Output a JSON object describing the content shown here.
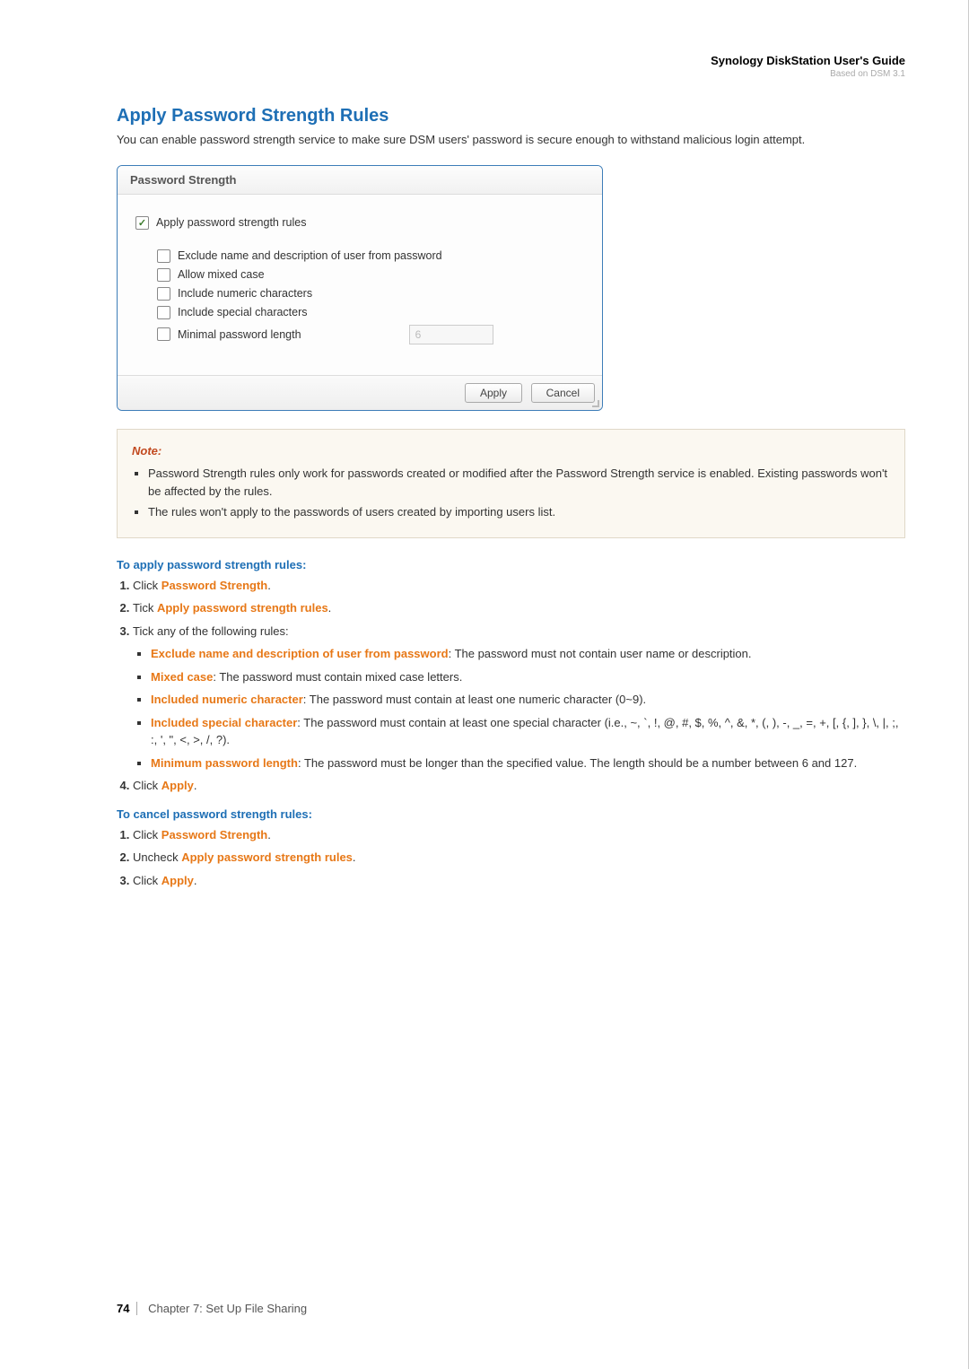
{
  "header": {
    "guide_title": "Synology DiskStation User's Guide",
    "guide_sub": "Based on DSM 3.1"
  },
  "section": {
    "title": "Apply Password Strength Rules",
    "intro": "You can enable password strength service to make sure DSM users' password is secure enough to withstand malicious login attempt."
  },
  "panel": {
    "title": "Password Strength",
    "main_rule": "Apply password strength rules",
    "sub_rules": {
      "exclude": "Exclude name and description of user from password",
      "mixed": "Allow mixed case",
      "numeric": "Include numeric characters",
      "special": "Include special characters",
      "minlen": "Minimal password length"
    },
    "minlen_value": "6",
    "buttons": {
      "apply": "Apply",
      "cancel": "Cancel"
    }
  },
  "note": {
    "label": "Note:",
    "items": [
      "Password Strength rules only work for passwords created or modified after the Password Strength service is enabled. Existing passwords won't be affected by the rules.",
      "The rules won't apply to the passwords of users created by importing users list."
    ]
  },
  "apply_steps": {
    "heading": "To apply password strength rules:",
    "step1_pre": "Click ",
    "step1_kw": "Password Strength",
    "step2_pre": "Tick ",
    "step2_kw": "Apply password strength rules",
    "step3": "Tick any of the following rules:",
    "rules": {
      "exclude_kw": "Exclude name and description of user from password",
      "exclude_txt": ": The password must not contain user name or description.",
      "mixed_kw": "Mixed case",
      "mixed_txt": ": The password must contain mixed case letters.",
      "numeric_kw": "Included numeric character",
      "numeric_txt": ": The password must contain at least one numeric character (0~9).",
      "special_kw": "Included special character",
      "special_txt": ": The password must contain at least one special character (i.e., ~, `, !, @, #, $, %, ^, &, *, (, ), -, _, =, +, [, {, ], }, \\, |, ;, :, ', \", <, >, /, ?).",
      "minlen_kw": "Minimum password length",
      "minlen_txt": ": The password must be longer than the specified value. The length should be a number between 6 and 127."
    },
    "step4_pre": "Click ",
    "step4_kw": "Apply"
  },
  "cancel_steps": {
    "heading": "To cancel password strength rules:",
    "step1_pre": "Click ",
    "step1_kw": "Password Strength",
    "step2_pre": "Uncheck ",
    "step2_kw": "Apply password strength rules",
    "step3_pre": "Click ",
    "step3_kw": "Apply"
  },
  "footer": {
    "page": "74",
    "chapter": "Chapter 7: Set Up File Sharing"
  }
}
